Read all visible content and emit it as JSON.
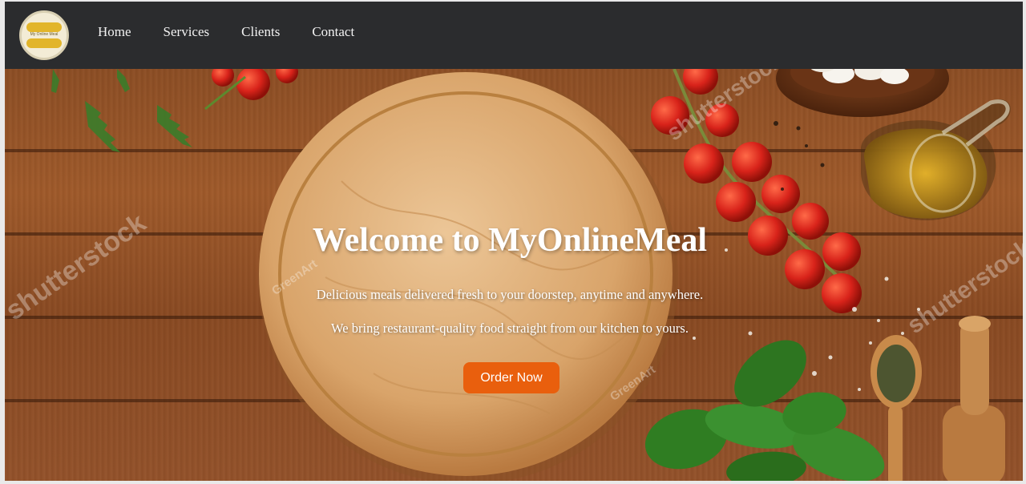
{
  "brand": {
    "logo_text": "My Online Meal"
  },
  "nav": {
    "items": [
      {
        "label": "Home"
      },
      {
        "label": "Services"
      },
      {
        "label": "Clients"
      },
      {
        "label": "Contact"
      }
    ]
  },
  "hero": {
    "title": "Welcome to MyOnlineMeal",
    "line1": "Delicious meals delivered fresh to your doorstep, anytime and anywhere.",
    "line2": "We bring restaurant-quality food straight from our kitchen to yours.",
    "cta_label": "Order Now"
  },
  "watermarks": {
    "stock": "shutterstock",
    "artist": "GreenArt"
  },
  "colors": {
    "nav_bg": "#2b2c2e",
    "cta": "#e95f0d",
    "wood": "#9a5628"
  }
}
